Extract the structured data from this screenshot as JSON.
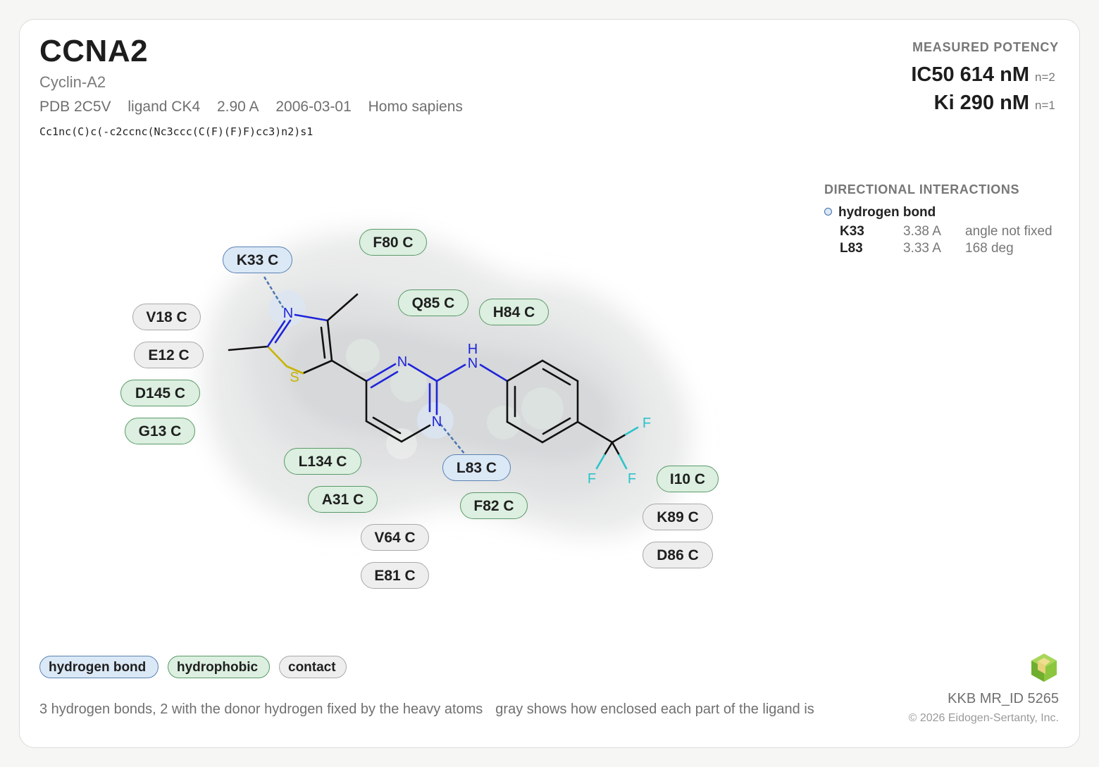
{
  "header": {
    "title": "CCNA2",
    "subtitle": "Cyclin-A2",
    "pdb": "PDB 2C5V",
    "ligand": "ligand CK4",
    "resolution": "2.90 A",
    "date": "2006-03-01",
    "organism": "Homo sapiens",
    "smiles": "Cc1nc(C)c(-c2ccnc(Nc3ccc(C(F)(F)F)cc3)n2)s1"
  },
  "potency": {
    "heading": "MEASURED POTENCY",
    "ic50": "IC50 614 nM",
    "ic50_n": "n=2",
    "ki": "Ki 290 nM",
    "ki_n": "n=1"
  },
  "directional": {
    "heading": "DIRECTIONAL INTERACTIONS",
    "type": "hydrogen bond",
    "rows": [
      {
        "residue": "K33",
        "distance": "3.38 A",
        "angle": "angle not fixed"
      },
      {
        "residue": "L83",
        "distance": "3.33 A",
        "angle": "168 deg"
      }
    ]
  },
  "residues": {
    "k33": "K33 C",
    "f80": "F80 C",
    "q85": "Q85 C",
    "h84": "H84 C",
    "v18": "V18 C",
    "e12": "E12 C",
    "d145": "D145 C",
    "g13": "G13 C",
    "l134": "L134 C",
    "a31": "A31 C",
    "v64": "V64 C",
    "e81": "E81 C",
    "l83": "L83 C",
    "f82": "F82 C",
    "i10": "I10 C",
    "k89": "K89 C",
    "d86": "D86 C"
  },
  "atoms": {
    "n_thiazole": "N",
    "s_thiazole": "S",
    "n_pyr_top": "N",
    "n_pyr_bottom": "N",
    "nh_n": "N",
    "nh_h": "H",
    "f1": "F",
    "f2": "F",
    "f3": "F"
  },
  "legend": {
    "hbond": "hydrogen bond",
    "hydrophobic": "hydrophobic",
    "contact": "contact"
  },
  "footer": {
    "note1": "3 hydrogen bonds, 2 with the donor hydrogen fixed by the heavy atoms",
    "note2": "gray shows how enclosed each part of the ligand is",
    "id": "KKB MR_ID 5265",
    "copyright": "© 2026 Eidogen-Sertanty, Inc."
  },
  "colors": {
    "hbond_fill": "#dbe8f6",
    "hbond_border": "#5b82b4",
    "hydrophobic_fill": "#dcefe0",
    "hydrophobic_border": "#5a9a68",
    "contact_fill": "#eeeeee",
    "contact_border": "#a9a9a9",
    "nitrogen": "#1f25d8",
    "sulfur": "#c8b400",
    "fluorine": "#2cc4c9"
  },
  "icons": {
    "logo": "hexagon-cube-logo-icon"
  }
}
